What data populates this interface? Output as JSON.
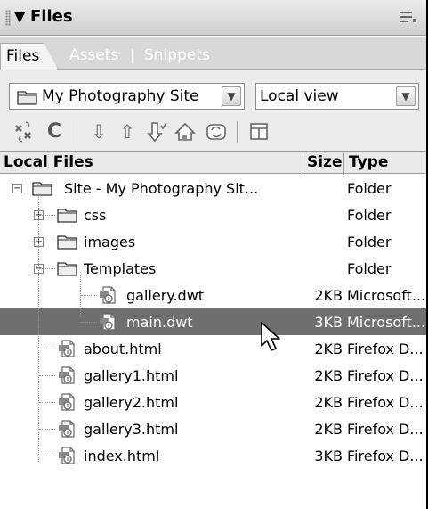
{
  "panel": {
    "title": "Files",
    "collapse_glyph": "▼"
  },
  "tabs": [
    {
      "label": "Files",
      "active": true
    },
    {
      "label": "Assets",
      "active": false
    },
    {
      "label": "Snippets",
      "active": false
    }
  ],
  "site_select": {
    "value": "My Photography Site",
    "icon": "site-folder-icon"
  },
  "view_select": {
    "value": "Local view"
  },
  "toolbar": [
    {
      "name": "connect-icon",
      "glyph": "⇌"
    },
    {
      "name": "refresh-icon",
      "glyph": "C"
    },
    {
      "name": "get-files-icon",
      "glyph": "⇩"
    },
    {
      "name": "put-files-icon",
      "glyph": "⇧"
    },
    {
      "name": "check-out-icon",
      "glyph": "⇩"
    },
    {
      "name": "check-in-icon",
      "glyph": "⇧"
    },
    {
      "name": "synchronize-icon",
      "glyph": "↻"
    },
    {
      "name": "expand-icon",
      "glyph": "◨"
    }
  ],
  "columns": {
    "name": "Local Files",
    "size": "Size",
    "type": "Type"
  },
  "files": [
    {
      "name": "Site - My Photography Sit...",
      "size": "",
      "type": "Folder",
      "kind": "site",
      "level": 0,
      "expander": "−"
    },
    {
      "name": "css",
      "size": "",
      "type": "Folder",
      "kind": "folder",
      "level": 1,
      "expander": "+"
    },
    {
      "name": "images",
      "size": "",
      "type": "Folder",
      "kind": "folder",
      "level": 1,
      "expander": "+"
    },
    {
      "name": "Templates",
      "size": "",
      "type": "Folder",
      "kind": "folder",
      "level": 1,
      "expander": "−"
    },
    {
      "name": "gallery.dwt",
      "size": "2KB",
      "type": "Microsoft...",
      "kind": "file",
      "level": 2
    },
    {
      "name": "main.dwt",
      "size": "3KB",
      "type": "Microsoft...",
      "kind": "file",
      "level": 2,
      "selected": true
    },
    {
      "name": "about.html",
      "size": "2KB",
      "type": "Firefox D...",
      "kind": "file",
      "level": 1
    },
    {
      "name": "gallery1.html",
      "size": "2KB",
      "type": "Firefox D...",
      "kind": "file",
      "level": 1
    },
    {
      "name": "gallery2.html",
      "size": "2KB",
      "type": "Firefox D...",
      "kind": "file",
      "level": 1
    },
    {
      "name": "gallery3.html",
      "size": "2KB",
      "type": "Firefox D...",
      "kind": "file",
      "level": 1
    },
    {
      "name": "index.html",
      "size": "3KB",
      "type": "Firefox D...",
      "kind": "file",
      "level": 1
    }
  ],
  "colors": {
    "selected_row": "#6f6f6f",
    "panel_bg": "#ececec"
  }
}
